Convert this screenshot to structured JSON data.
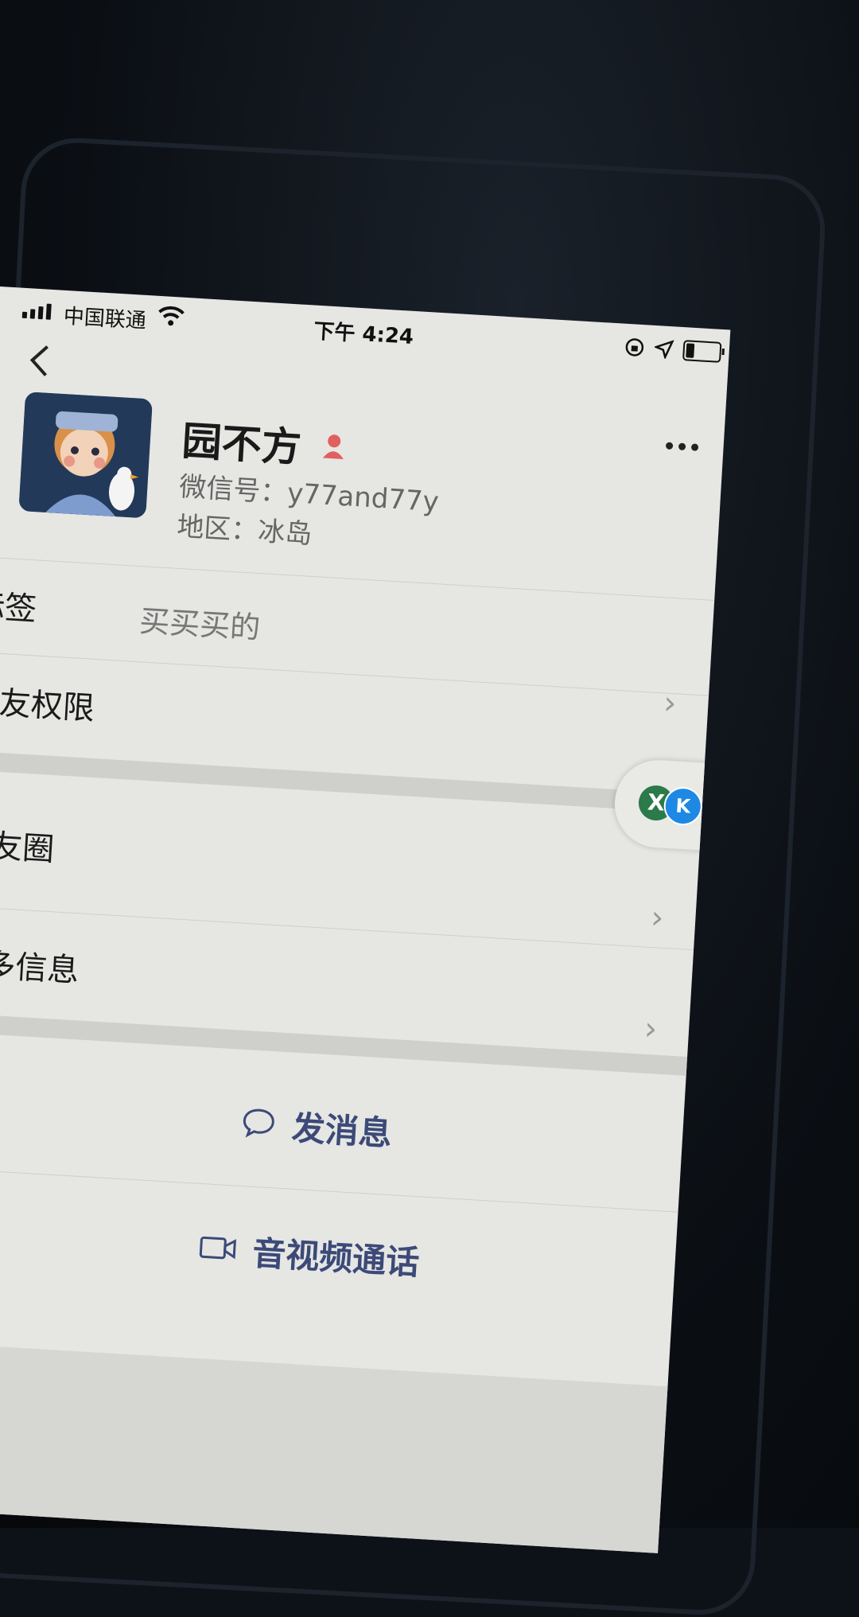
{
  "status_bar": {
    "carrier": "中国联通",
    "time": "下午 4:24",
    "battery_level": 0.25
  },
  "profile": {
    "name": "园不方",
    "wechat_id_label": "微信号：",
    "wechat_id": "y77and77y",
    "region_label": "地区：",
    "region": "冰岛"
  },
  "rows": {
    "tags_label": "标签",
    "tags_value": "买买买的",
    "friend_permission_label": "朋友权限",
    "moments_label": "朋友圈",
    "more_info_label": "更多信息"
  },
  "floating_pill": {
    "icon_x": "X",
    "icon_blue": "K"
  },
  "actions": {
    "send_message": "发消息",
    "av_call": "音视频通话"
  },
  "colors": {
    "action_text": "#3c4a78",
    "gender_icon": "#e06060"
  }
}
